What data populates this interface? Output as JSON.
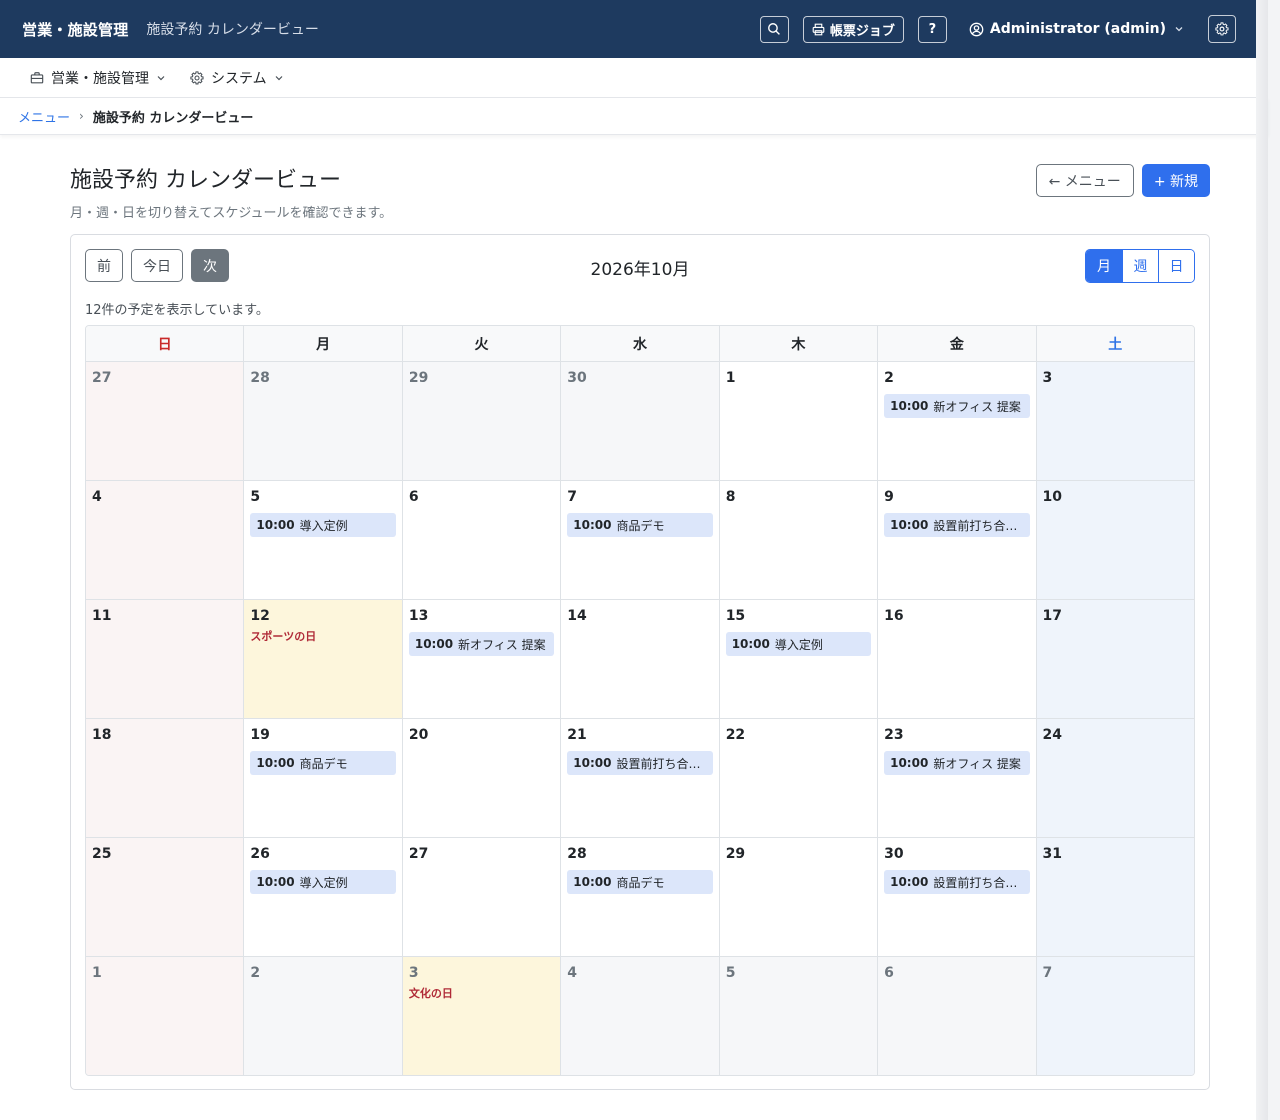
{
  "topbar": {
    "brand": "営業・施設管理",
    "subtitle": "施設予約 カレンダービュー",
    "print_jobs_label": "帳票ジョブ",
    "help_label": "?",
    "user_label": "Administrator (admin)"
  },
  "menubar": {
    "items": [
      {
        "label": "営業・施設管理",
        "icon": "briefcase-icon"
      },
      {
        "label": "システム",
        "icon": "gear-icon"
      }
    ]
  },
  "breadcrumb": {
    "menu_link": "メニュー",
    "separator": "›",
    "current": "施設予約 カレンダービュー"
  },
  "page": {
    "title": "施設予約 カレンダービュー",
    "description": "月・週・日を切り替えてスケジュールを確認できます。",
    "back_button": "← メニュー",
    "new_button": "+ 新規"
  },
  "calendar": {
    "prev_label": "前",
    "today_label": "今日",
    "next_label": "次",
    "month_title": "2026年10月",
    "views": [
      "月",
      "週",
      "日"
    ],
    "active_view": "月",
    "count_text": "12件の予定を表示しています。",
    "weekdays": [
      "日",
      "月",
      "火",
      "水",
      "木",
      "金",
      "土"
    ],
    "weeks": [
      [
        {
          "day": "27",
          "other": true,
          "events": []
        },
        {
          "day": "28",
          "other": true,
          "events": []
        },
        {
          "day": "29",
          "other": true,
          "events": []
        },
        {
          "day": "30",
          "other": true,
          "events": []
        },
        {
          "day": "1",
          "events": []
        },
        {
          "day": "2",
          "events": [
            {
              "time": "10:00",
              "title": "新オフィス 提案"
            }
          ]
        },
        {
          "day": "3",
          "events": []
        }
      ],
      [
        {
          "day": "4",
          "events": []
        },
        {
          "day": "5",
          "events": [
            {
              "time": "10:00",
              "title": "導入定例"
            }
          ]
        },
        {
          "day": "6",
          "events": []
        },
        {
          "day": "7",
          "events": [
            {
              "time": "10:00",
              "title": "商品デモ"
            }
          ]
        },
        {
          "day": "8",
          "events": []
        },
        {
          "day": "9",
          "events": [
            {
              "time": "10:00",
              "title": "設置前打ち合わ..."
            }
          ]
        },
        {
          "day": "10",
          "events": []
        }
      ],
      [
        {
          "day": "11",
          "events": []
        },
        {
          "day": "12",
          "holiday": "スポーツの日",
          "events": []
        },
        {
          "day": "13",
          "events": [
            {
              "time": "10:00",
              "title": "新オフィス 提案"
            }
          ]
        },
        {
          "day": "14",
          "events": []
        },
        {
          "day": "15",
          "events": [
            {
              "time": "10:00",
              "title": "導入定例"
            }
          ]
        },
        {
          "day": "16",
          "events": []
        },
        {
          "day": "17",
          "events": []
        }
      ],
      [
        {
          "day": "18",
          "events": []
        },
        {
          "day": "19",
          "events": [
            {
              "time": "10:00",
              "title": "商品デモ"
            }
          ]
        },
        {
          "day": "20",
          "events": []
        },
        {
          "day": "21",
          "events": [
            {
              "time": "10:00",
              "title": "設置前打ち合わ..."
            }
          ]
        },
        {
          "day": "22",
          "events": []
        },
        {
          "day": "23",
          "events": [
            {
              "time": "10:00",
              "title": "新オフィス 提案"
            }
          ]
        },
        {
          "day": "24",
          "events": []
        }
      ],
      [
        {
          "day": "25",
          "events": []
        },
        {
          "day": "26",
          "events": [
            {
              "time": "10:00",
              "title": "導入定例"
            }
          ]
        },
        {
          "day": "27",
          "events": []
        },
        {
          "day": "28",
          "events": [
            {
              "time": "10:00",
              "title": "商品デモ"
            }
          ]
        },
        {
          "day": "29",
          "events": []
        },
        {
          "day": "30",
          "events": [
            {
              "time": "10:00",
              "title": "設置前打ち合わ..."
            }
          ]
        },
        {
          "day": "31",
          "events": []
        }
      ],
      [
        {
          "day": "1",
          "other": true,
          "events": []
        },
        {
          "day": "2",
          "other": true,
          "events": []
        },
        {
          "day": "3",
          "other": true,
          "holiday": "文化の日",
          "events": []
        },
        {
          "day": "4",
          "other": true,
          "events": []
        },
        {
          "day": "5",
          "other": true,
          "events": []
        },
        {
          "day": "6",
          "other": true,
          "events": []
        },
        {
          "day": "7",
          "other": true,
          "events": []
        }
      ]
    ]
  },
  "colors": {
    "header_bg": "#1e3a5f",
    "primary": "#2f6fed",
    "event_bg": "#dce6fa",
    "holiday_bg": "#fdf6dc",
    "sunday": "#c92a2a",
    "saturday": "#2f74e6"
  }
}
